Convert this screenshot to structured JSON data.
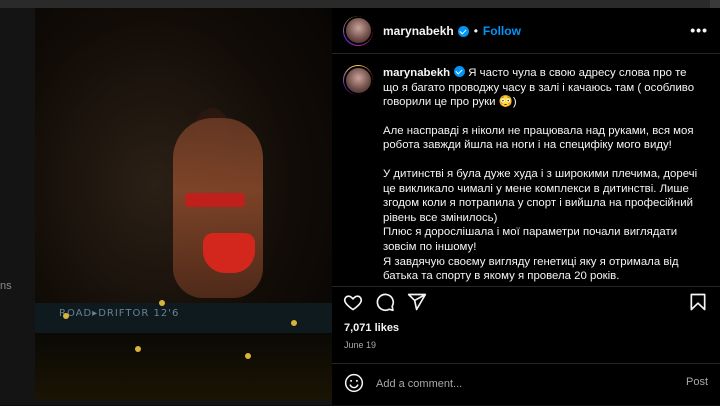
{
  "post": {
    "username": "marynabekh",
    "follow_label": "Follow",
    "separator": "•",
    "more_label": "•••",
    "caption": {
      "p1": "Я часто чула в свою адресу слова про те що я багато проводжу часу в залі і качаюсь там ( особливо говорили це про руки 😳)",
      "p2": "Але насправді я ніколи не працювала над руками, вся моя робота завжди йшла на ноги і на специфіку мого виду!",
      "p3": "У дитинстві я була дуже худа і з широкими плечима, доречі це викликало чималі у мене комплекси в дитинстві. Лише згодом коли я потрапила у спорт і вийшла на професійний рівень все змінилось)",
      "p4": "Плюс я дорослішала і мої параметри почали виглядати зовсім по іншому!",
      "p5": "Я завдячую своєму вигляду генетиці яку я отримала від батька та спорту в якому я провела 20 років."
    },
    "likes": "7,071 likes",
    "date": "June 19"
  },
  "comment": {
    "placeholder": "Add a comment...",
    "post_label": "Post"
  },
  "photo": {
    "board_text": "ROAD▸DRIFTOR 12'6"
  },
  "backdrop": {
    "edge_text": "ns"
  },
  "icons": {
    "like": "heart-icon",
    "comment": "comment-icon",
    "share": "share-icon",
    "save": "bookmark-icon",
    "emoji": "emoji-icon",
    "more": "more-icon",
    "verified": "verified-badge-icon"
  },
  "colors": {
    "accent": "#0095f6",
    "panel_bg": "#000000",
    "divider": "#262626",
    "muted": "#a8a8a8"
  }
}
